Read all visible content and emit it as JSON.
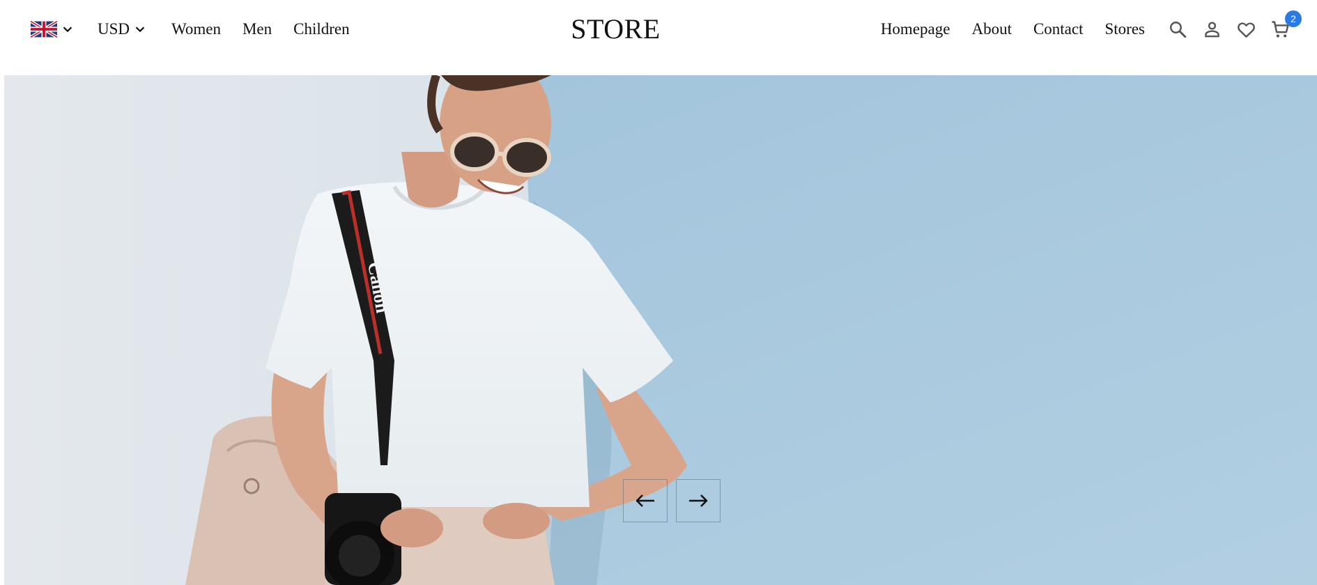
{
  "header": {
    "language_icon": "uk-flag-icon",
    "currency": "USD",
    "left_links": [
      "Women",
      "Men",
      "Children"
    ],
    "logo": "STORE",
    "right_links": [
      "Homepage",
      "About",
      "Contact",
      "Stores"
    ],
    "icons": [
      "search-icon",
      "user-icon",
      "heart-icon",
      "cart-icon"
    ],
    "cart_count": "2"
  },
  "hero": {
    "image": "woman in white t-shirt with sunglasses and camera leaning on a blue wall",
    "camera_strap_text": "Canon",
    "controls": [
      "arrow-left-icon",
      "arrow-right-icon"
    ]
  },
  "colors": {
    "accent": "#2a7ae4",
    "wall_blue": "#a8c8df",
    "wall_white": "#e3e8ec"
  }
}
